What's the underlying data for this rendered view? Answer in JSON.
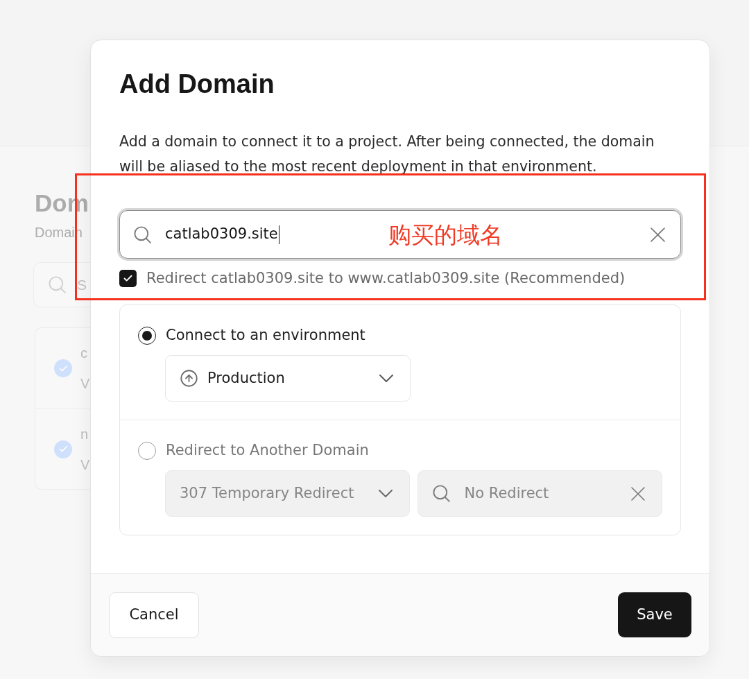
{
  "background_page": {
    "title": "Dom",
    "subtitle": "Domain",
    "search": {
      "placeholder": "S"
    },
    "domains": [
      {
        "name": "c",
        "status": "V",
        "verified": true
      },
      {
        "name": "n",
        "status": "V",
        "verified": true
      }
    ]
  },
  "dialog": {
    "title": "Add Domain",
    "description": "Add a domain to connect it to a project. After being connected, the domain will be aliased to the most recent deployment in that environment.",
    "domain_field": {
      "value": "catlab0309.site",
      "focused": true
    },
    "redirect_www": {
      "label": "Redirect catlab0309.site to www.catlab0309.site (Recommended)",
      "checked": true
    },
    "options": [
      {
        "kind": "environment",
        "label": "Connect to an environment",
        "selected": true,
        "environment": "Production"
      },
      {
        "kind": "redirect",
        "label": "Redirect to Another Domain",
        "selected": false,
        "redirect_type": "307 Temporary Redirect",
        "target_placeholder": "No Redirect"
      }
    ],
    "buttons": [
      {
        "kind": "secondary",
        "label": "Cancel"
      },
      {
        "kind": "primary",
        "label": "Save"
      }
    ]
  },
  "annotation": {
    "label": "购买的域名"
  }
}
